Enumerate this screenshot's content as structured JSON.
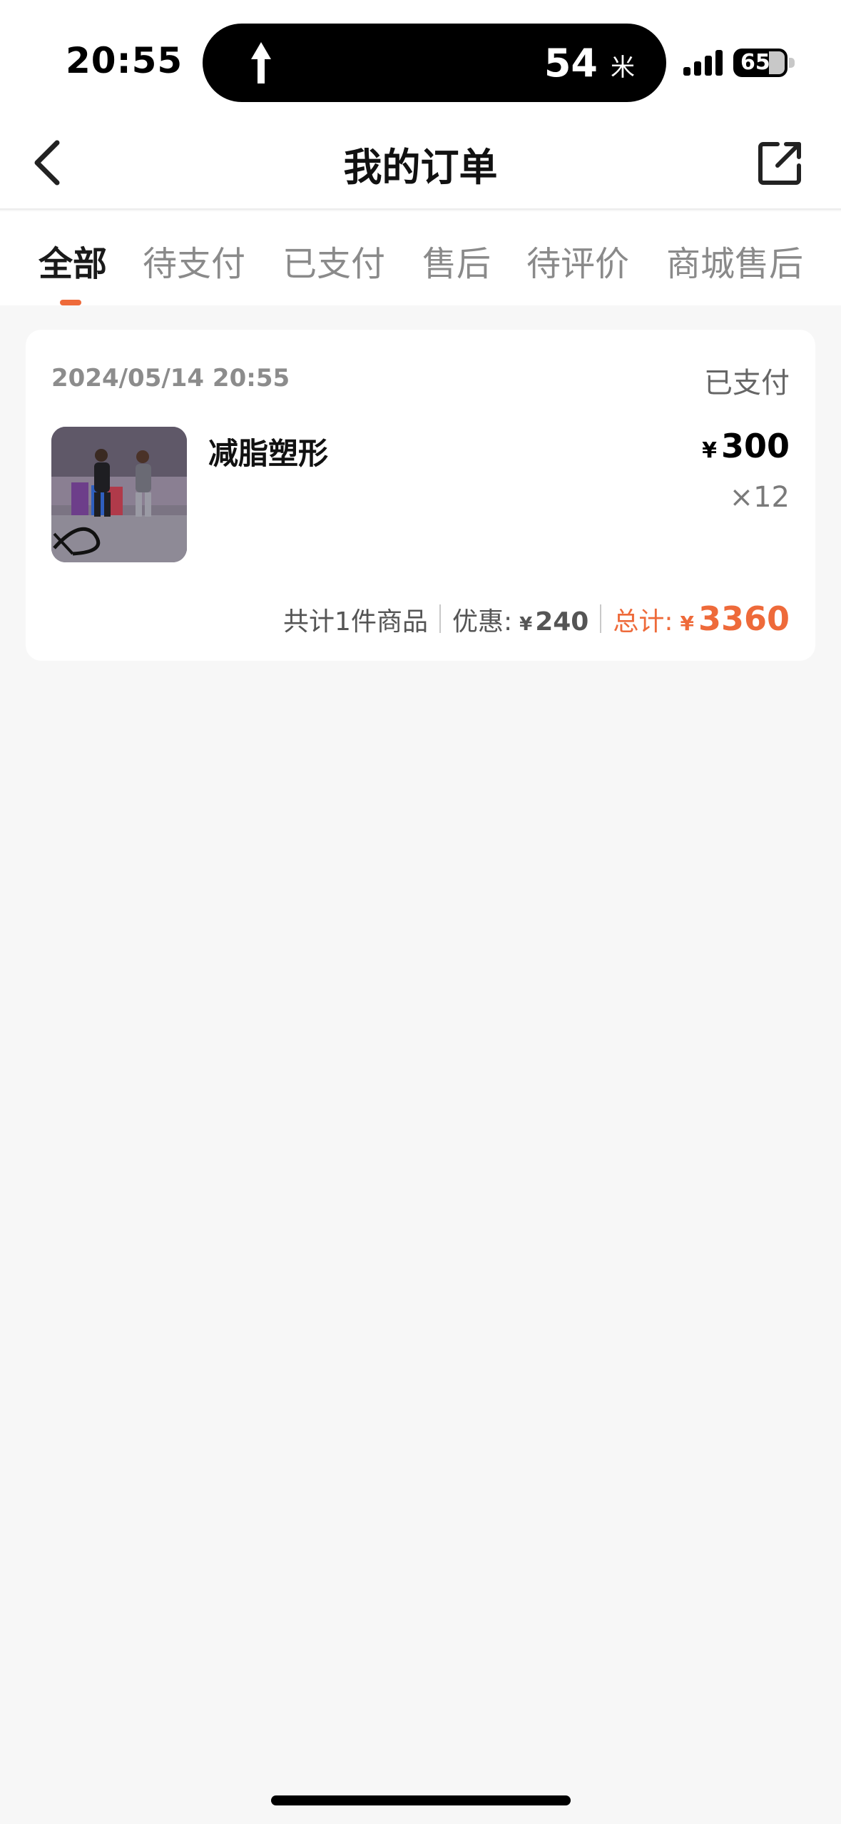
{
  "status_bar": {
    "time": "20:55",
    "island_temperature": "54",
    "island_unit": "米",
    "battery_level": "65"
  },
  "navbar": {
    "title": "我的订单",
    "back_icon": "chevron-left-icon",
    "share_icon": "external-link-icon"
  },
  "tabs": [
    {
      "label": "全部",
      "active": true
    },
    {
      "label": "待支付",
      "active": false
    },
    {
      "label": "已支付",
      "active": false
    },
    {
      "label": "售后",
      "active": false
    },
    {
      "label": "待评价",
      "active": false
    },
    {
      "label": "商城售后",
      "active": false
    }
  ],
  "orders": [
    {
      "date": "2024/05/14 20:55",
      "status": "已支付",
      "product_name": "减脂塑形",
      "price_currency": "¥",
      "price": "300",
      "quantity": "×12",
      "summary": {
        "count_text": "共计1件商品",
        "discount_label": "优惠:",
        "discount_currency": "¥",
        "discount_value": "240",
        "total_label": "总计:",
        "total_currency": "¥",
        "total_value": "3360"
      }
    }
  ],
  "colors": {
    "accent": "#ee6a3a",
    "background": "#f7f7f7",
    "card": "#ffffff"
  }
}
